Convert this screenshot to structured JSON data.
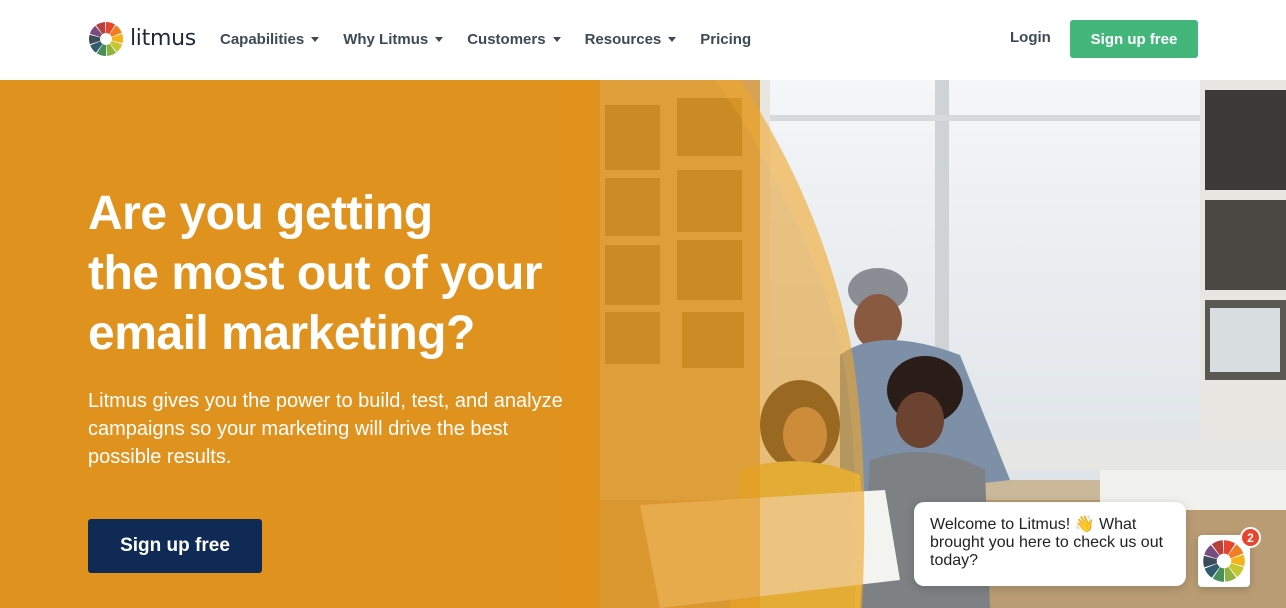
{
  "brand": {
    "name": "litmus",
    "wheel_colors": [
      "#e8452f",
      "#f27c21",
      "#f6b21b",
      "#c8c730",
      "#8db43e",
      "#4a8f5b",
      "#2f5d6e",
      "#3d4a57",
      "#7a4b7f",
      "#b8413d"
    ]
  },
  "nav": {
    "items": [
      {
        "label": "Capabilities",
        "has_dropdown": true
      },
      {
        "label": "Why Litmus",
        "has_dropdown": true
      },
      {
        "label": "Customers",
        "has_dropdown": true
      },
      {
        "label": "Resources",
        "has_dropdown": true
      },
      {
        "label": "Pricing",
        "has_dropdown": false
      }
    ],
    "login_label": "Login",
    "signup_label": "Sign up free"
  },
  "hero": {
    "headline": [
      "Are you getting",
      "the most out of your",
      "email marketing?"
    ],
    "subtext": "Litmus gives you the power to build, test, and analyze campaigns so your marketing will drive the best possible results.",
    "cta_label": "Sign up free"
  },
  "chat": {
    "message": "Welcome to Litmus! 👋 What brought you here to check us out today?",
    "badge_count": "2"
  },
  "colors": {
    "accent_green": "#43b77b",
    "hero_orange": "#e0921e",
    "cta_navy": "#0f2a55",
    "badge_red": "#e8452f"
  }
}
